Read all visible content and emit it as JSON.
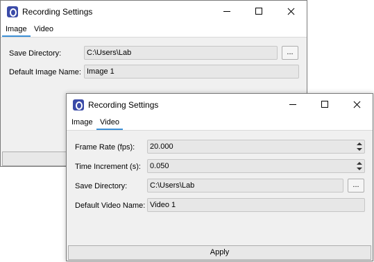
{
  "back_window": {
    "title": "Recording Settings",
    "tabs": [
      {
        "label": "Image",
        "active": true
      },
      {
        "label": "Video",
        "active": false
      }
    ],
    "image_tab": {
      "save_directory_label": "Save Directory:",
      "save_directory_value": "C:\\Users\\Lab",
      "browse_label": "...",
      "default_image_name_label": "Default Image Name:",
      "default_image_name_value": "Image 1"
    }
  },
  "front_window": {
    "title": "Recording Settings",
    "tabs": [
      {
        "label": "Image",
        "active": false
      },
      {
        "label": "Video",
        "active": true
      }
    ],
    "video_tab": {
      "frame_rate_label": "Frame Rate (fps):",
      "frame_rate_value": "20.000",
      "time_increment_label": "Time Increment (s):",
      "time_increment_value": "0.050",
      "save_directory_label": "Save Directory:",
      "save_directory_value": "C:\\Users\\Lab",
      "browse_label": "...",
      "default_video_name_label": "Default Video Name:",
      "default_video_name_value": "Video 1"
    },
    "apply_label": "Apply"
  },
  "icons": {
    "app": "app-logo-icon",
    "minimize": "minimize-icon",
    "maximize": "maximize-icon",
    "close": "close-icon",
    "spin_up": "spin-up-icon",
    "spin_down": "spin-down-icon"
  },
  "colors": {
    "accent": "#3b8fd6",
    "app_icon": "#3b4ba8",
    "panel_bg": "#f0f0f0",
    "field_bg": "#e7e7e7"
  }
}
